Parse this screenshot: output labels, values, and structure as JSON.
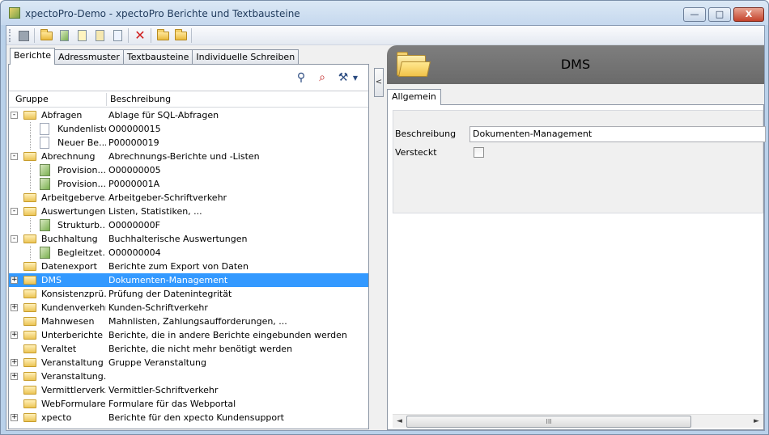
{
  "window": {
    "title": "xpectoPro-Demo - xpectoPro Berichte und Textbausteine",
    "min_glyph": "—",
    "max_glyph": "□",
    "close_glyph": "X"
  },
  "toolbar": {
    "icons": [
      "save-icon",
      "open-folder-icon",
      "report-icon",
      "copy-icon",
      "spellcheck-icon",
      "edit-icon",
      "delete-icon",
      "folder-open-icon",
      "folder-new-icon"
    ]
  },
  "left_tabs": [
    "Berichte",
    "Adressmuster",
    "Textbausteine",
    "Individuelle Schreiben"
  ],
  "search_icons": [
    "search-icon",
    "clear-search-icon",
    "tools-icon"
  ],
  "tree": {
    "columns": [
      "Gruppe",
      "Beschreibung"
    ],
    "rows": [
      {
        "name": "Abfragen",
        "desc": "Ablage für SQL-Abfragen",
        "level": 0,
        "expander": "-",
        "icon": "folder"
      },
      {
        "name": "Kundenliste",
        "desc": "O00000015",
        "level": 1,
        "icon": "doc"
      },
      {
        "name": "Neuer Be...",
        "desc": "P00000019",
        "level": 1,
        "icon": "doc"
      },
      {
        "name": "Abrechnung",
        "desc": "Abrechnungs-Berichte und -Listen",
        "level": 0,
        "expander": "-",
        "icon": "folder"
      },
      {
        "name": "Provision...",
        "desc": "O00000005",
        "level": 1,
        "icon": "file"
      },
      {
        "name": "Provision...",
        "desc": "P0000001A",
        "level": 1,
        "icon": "file"
      },
      {
        "name": "Arbeitgeberve...",
        "desc": "Arbeitgeber-Schriftverkehr",
        "level": 0,
        "icon": "folder"
      },
      {
        "name": "Auswertungen",
        "desc": "Listen, Statistiken, ...",
        "level": 0,
        "expander": "-",
        "icon": "folder"
      },
      {
        "name": "Strukturb...",
        "desc": "O0000000F",
        "level": 1,
        "icon": "file"
      },
      {
        "name": "Buchhaltung",
        "desc": "Buchhalterische Auswertungen",
        "level": 0,
        "expander": "-",
        "icon": "folder"
      },
      {
        "name": "Begleitzet...",
        "desc": "O00000004",
        "level": 1,
        "icon": "file"
      },
      {
        "name": "Datenexport",
        "desc": "Berichte zum Export von Daten",
        "level": 0,
        "icon": "folder"
      },
      {
        "name": "DMS",
        "desc": "Dokumenten-Management",
        "level": 0,
        "expander": "+",
        "icon": "folder",
        "selected": true
      },
      {
        "name": "Konsistenzprü...",
        "desc": "Prüfung der Datenintegrität",
        "level": 0,
        "icon": "folder"
      },
      {
        "name": "Kundenverkehr",
        "desc": "Kunden-Schriftverkehr",
        "level": 0,
        "expander": "+",
        "icon": "folder"
      },
      {
        "name": "Mahnwesen",
        "desc": "Mahnlisten, Zahlungsaufforderungen, ...",
        "level": 0,
        "icon": "folder"
      },
      {
        "name": "Unterberichte",
        "desc": "Berichte, die in andere Berichte eingebunden werden",
        "level": 0,
        "expander": "+",
        "icon": "folder"
      },
      {
        "name": "Veraltet",
        "desc": "Berichte, die nicht mehr benötigt werden",
        "level": 0,
        "icon": "folder"
      },
      {
        "name": "Veranstaltung",
        "desc": "Gruppe Veranstaltung",
        "level": 0,
        "expander": "+",
        "icon": "folder"
      },
      {
        "name": "Veranstaltung...",
        "desc": "",
        "level": 0,
        "expander": "+",
        "icon": "folder"
      },
      {
        "name": "Vermittlerverk...",
        "desc": "Vermittler-Schriftverkehr",
        "level": 0,
        "icon": "folder"
      },
      {
        "name": "WebFormulare",
        "desc": "Formulare für das Webportal",
        "level": 0,
        "icon": "folder"
      },
      {
        "name": "xpecto",
        "desc": "Berichte für den xpecto Kundensupport",
        "level": 0,
        "expander": "+",
        "icon": "folder"
      }
    ]
  },
  "detail": {
    "collapse_glyph": "<",
    "title": "DMS",
    "tab": "Allgemein",
    "fields": {
      "beschreibung_label": "Beschreibung",
      "beschreibung_value": "Dokumenten-Management",
      "versteckt_label": "Versteckt",
      "versteckt_checked": false
    },
    "scroll_left": "◄",
    "scroll_right": "►",
    "scroll_grip": "III"
  },
  "colors": {
    "selection": "#3399ff",
    "header_band": "#767676"
  }
}
